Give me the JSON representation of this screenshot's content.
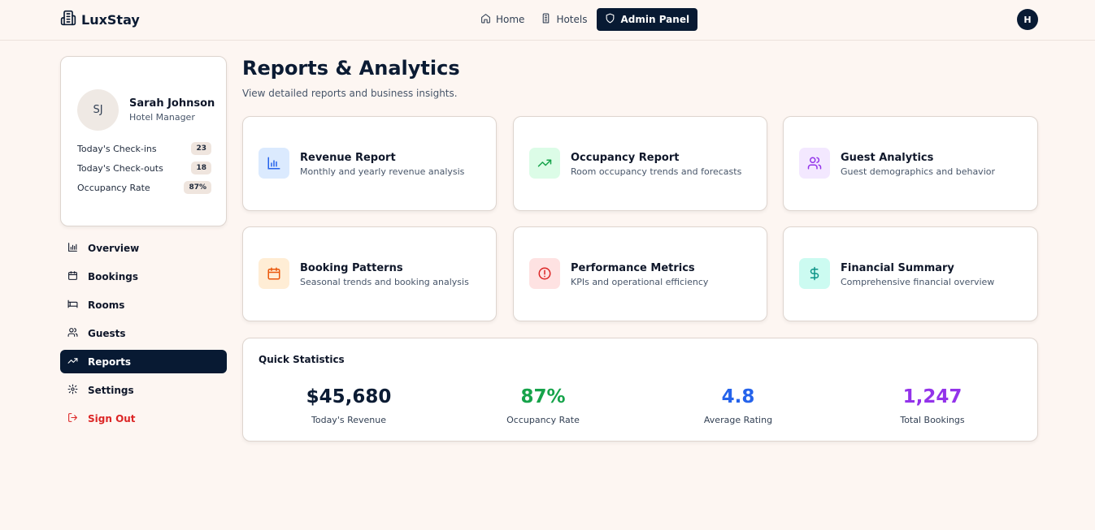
{
  "brand": {
    "name": "LuxStay"
  },
  "nav": {
    "home": "Home",
    "hotels": "Hotels",
    "admin": "Admin Panel"
  },
  "user": {
    "initial": "H"
  },
  "profile": {
    "initials": "SJ",
    "name": "Sarah Johnson",
    "role": "Hotel Manager",
    "stats": [
      {
        "label": "Today's Check-ins",
        "value": "23"
      },
      {
        "label": "Today's Check-outs",
        "value": "18"
      },
      {
        "label": "Occupancy Rate",
        "value": "87%"
      }
    ]
  },
  "menu": [
    {
      "label": "Overview",
      "icon": "bar-chart-icon"
    },
    {
      "label": "Bookings",
      "icon": "calendar-icon"
    },
    {
      "label": "Rooms",
      "icon": "bed-icon"
    },
    {
      "label": "Guests",
      "icon": "users-icon"
    },
    {
      "label": "Reports",
      "icon": "trending-up-icon",
      "active": true
    },
    {
      "label": "Settings",
      "icon": "gear-icon"
    },
    {
      "label": "Sign Out",
      "icon": "logout-icon"
    }
  ],
  "page": {
    "title": "Reports & Analytics",
    "subtitle": "View detailed reports and business insights."
  },
  "reports": [
    {
      "title": "Revenue Report",
      "desc": "Monthly and yearly revenue analysis",
      "icon": "bar-chart-icon",
      "color": "#2563eb",
      "bg": "#dbeafe"
    },
    {
      "title": "Occupancy Report",
      "desc": "Room occupancy trends and forecasts",
      "icon": "trending-up-icon",
      "color": "#16a34a",
      "bg": "#dcfce7"
    },
    {
      "title": "Guest Analytics",
      "desc": "Guest demographics and behavior",
      "icon": "users-icon",
      "color": "#9333ea",
      "bg": "#f3e8ff"
    },
    {
      "title": "Booking Patterns",
      "desc": "Seasonal trends and booking analysis",
      "icon": "calendar-icon",
      "color": "#ea580c",
      "bg": "#ffedd5"
    },
    {
      "title": "Performance Metrics",
      "desc": "KPIs and operational efficiency",
      "icon": "alert-circle-icon",
      "color": "#dc2626",
      "bg": "#fee2e2"
    },
    {
      "title": "Financial Summary",
      "desc": "Comprehensive financial overview",
      "icon": "dollar-icon",
      "color": "#0d9488",
      "bg": "#ccfbf1"
    }
  ],
  "quick_stats": {
    "title": "Quick Statistics",
    "items": [
      {
        "value": "$45,680",
        "label": "Today's Revenue",
        "color": "#0b1b33"
      },
      {
        "value": "87%",
        "label": "Occupancy Rate",
        "color": "#16a34a"
      },
      {
        "value": "4.8",
        "label": "Average Rating",
        "color": "#2563eb"
      },
      {
        "value": "1,247",
        "label": "Total Bookings",
        "color": "#9333ea"
      }
    ]
  }
}
